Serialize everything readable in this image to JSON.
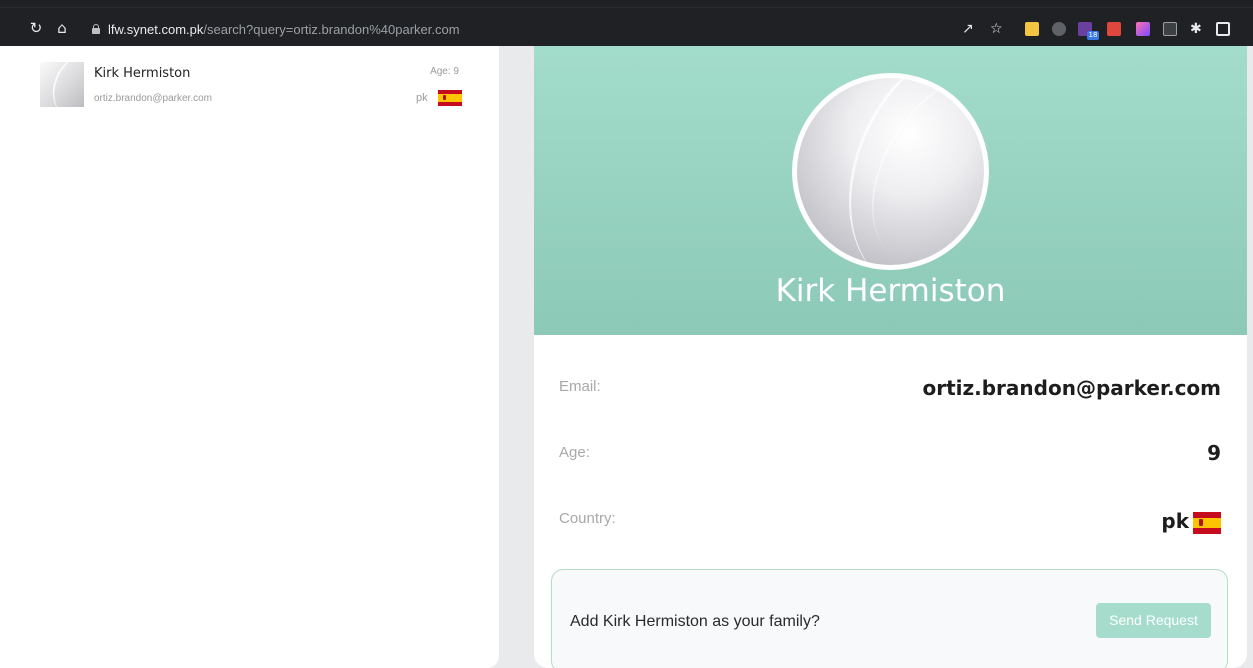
{
  "browser": {
    "url_host": "lfw.synet.com.pk",
    "url_path": "/search?query=ortiz.brandon%40parker.com",
    "extension_badge": "18",
    "icons": [
      "reload-icon",
      "home-icon",
      "lock-icon",
      "share-icon",
      "star-icon",
      "puzzle-icon",
      "side-panel-icon"
    ]
  },
  "results": [
    {
      "name": "Kirk Hermiston",
      "email": "ortiz.brandon@parker.com",
      "age_text": "Age: 9",
      "country": "pk"
    }
  ],
  "profile": {
    "name": "Kirk Hermiston",
    "email_label": "Email:",
    "email_value": "ortiz.brandon@parker.com",
    "age_label": "Age:",
    "age_value": "9",
    "country_label": "Country:",
    "country_value": "pk"
  },
  "request": {
    "prompt": "Add Kirk Hermiston as your family?",
    "button_label": "Send Request"
  },
  "colors": {
    "hero_top": "#a3dccb",
    "hero_bottom": "#8cc9b6",
    "button": "#a6dccb",
    "flag_red": "#c60b1e",
    "flag_yellow": "#ffc400"
  }
}
